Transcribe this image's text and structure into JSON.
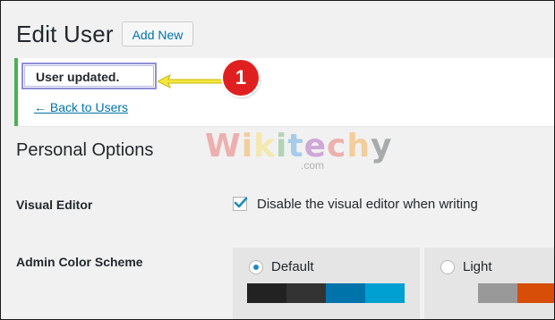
{
  "header": {
    "title": "Edit User",
    "add_new_label": "Add New"
  },
  "notice": {
    "message": "User updated.",
    "back_link": "← Back to Users",
    "annotation_number": "1"
  },
  "watermark": {
    "letters": [
      "W",
      "i",
      "k",
      "i",
      "t",
      "e",
      "c",
      "h",
      "y"
    ],
    "sub": ".com"
  },
  "personal_options": {
    "title": "Personal Options",
    "visual_editor": {
      "label": "Visual Editor",
      "checkbox_label": "Disable the visual editor when writing",
      "checked": true
    },
    "admin_color_scheme": {
      "label": "Admin Color Scheme",
      "schemes": [
        {
          "name": "Default",
          "selected": true,
          "colors": [
            "#222222",
            "#333333",
            "#0073aa",
            "#00a0d2"
          ]
        },
        {
          "name": "Light",
          "selected": false,
          "colors": [
            "#e5e5e5",
            "#999999",
            "#d64e07",
            "#04a4cc"
          ]
        }
      ]
    }
  },
  "colors": {
    "notice_border": "#46b450",
    "link": "#0073aa",
    "badge": "#e02020",
    "highlight_box": "#8f8fd6",
    "arrow": "#f5e642"
  }
}
